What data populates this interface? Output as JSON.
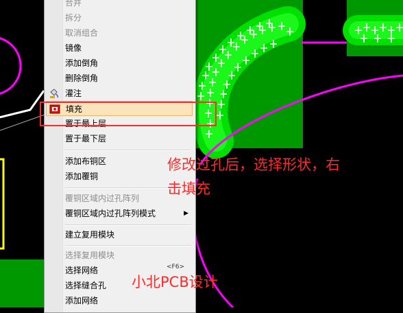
{
  "menu": {
    "items": [
      {
        "label": "合并",
        "disabled": true
      },
      {
        "label": "拆分",
        "disabled": true
      },
      {
        "label": "取消组合",
        "disabled": true
      },
      {
        "label": "镜像",
        "disabled": false
      },
      {
        "label": "添加倒角",
        "disabled": false
      },
      {
        "label": "删除倒角",
        "disabled": false
      },
      {
        "label": "灌注",
        "disabled": false,
        "icon": "pour-icon"
      },
      {
        "label": "填充",
        "disabled": false,
        "icon": "fill-icon",
        "highlighted": true
      },
      {
        "label": "置于最上层",
        "disabled": false
      },
      {
        "label": "置于最下层",
        "disabled": false
      },
      {
        "label": "添加布铜区",
        "disabled": false
      },
      {
        "label": "添加覆铜",
        "disabled": false
      },
      {
        "label": "覆铜区域内过孔阵列",
        "disabled": true
      },
      {
        "label": "覆铜区域内过孔阵列模式",
        "disabled": false,
        "submenu": true
      },
      {
        "label": "建立复用模块",
        "disabled": false
      },
      {
        "label": "选择复用模块",
        "disabled": true
      },
      {
        "label": "选择网络",
        "disabled": false,
        "shortcut": "<F6>"
      },
      {
        "label": "选择缝合孔",
        "disabled": false
      },
      {
        "label": "添加网络",
        "disabled": false
      }
    ]
  },
  "annotation": {
    "line1": "修改过孔后，选择形状，右",
    "line2": "击填充",
    "watermark": "小北PCB设计"
  },
  "colors": {
    "background": "#000000",
    "copper": "#00dd00",
    "copper_dark": "#00a800",
    "outline": "#ff00ff",
    "annotation": "#ff2a2a",
    "highlight": "#fbe3bc"
  }
}
